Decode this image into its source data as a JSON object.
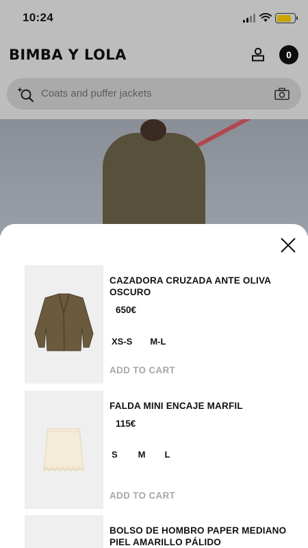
{
  "status_bar": {
    "time": "10:24"
  },
  "header": {
    "logo": "BIMBA Y LOLA",
    "cart_count": "0",
    "search_placeholder": "Coats and puffer jackets"
  },
  "colors": {
    "accent_battery": "#c9a400",
    "overlay": "#bdbdbd",
    "add_to_cart": "#a7a7a7"
  },
  "products": [
    {
      "title": "CAZADORA CRUZADA ANTE OLIVA OSCURO",
      "price": "650€",
      "sizes": [
        "XS-S",
        "M-L"
      ],
      "action": "ADD TO CART"
    },
    {
      "title": "FALDA MINI ENCAJE MARFIL",
      "price": "115€",
      "sizes": [
        "S",
        "M",
        "L"
      ],
      "action": "ADD TO CART"
    },
    {
      "title": "BOLSO DE HOMBRO PAPER MEDIANO PIEL AMARILLO PÁLIDO"
    }
  ]
}
